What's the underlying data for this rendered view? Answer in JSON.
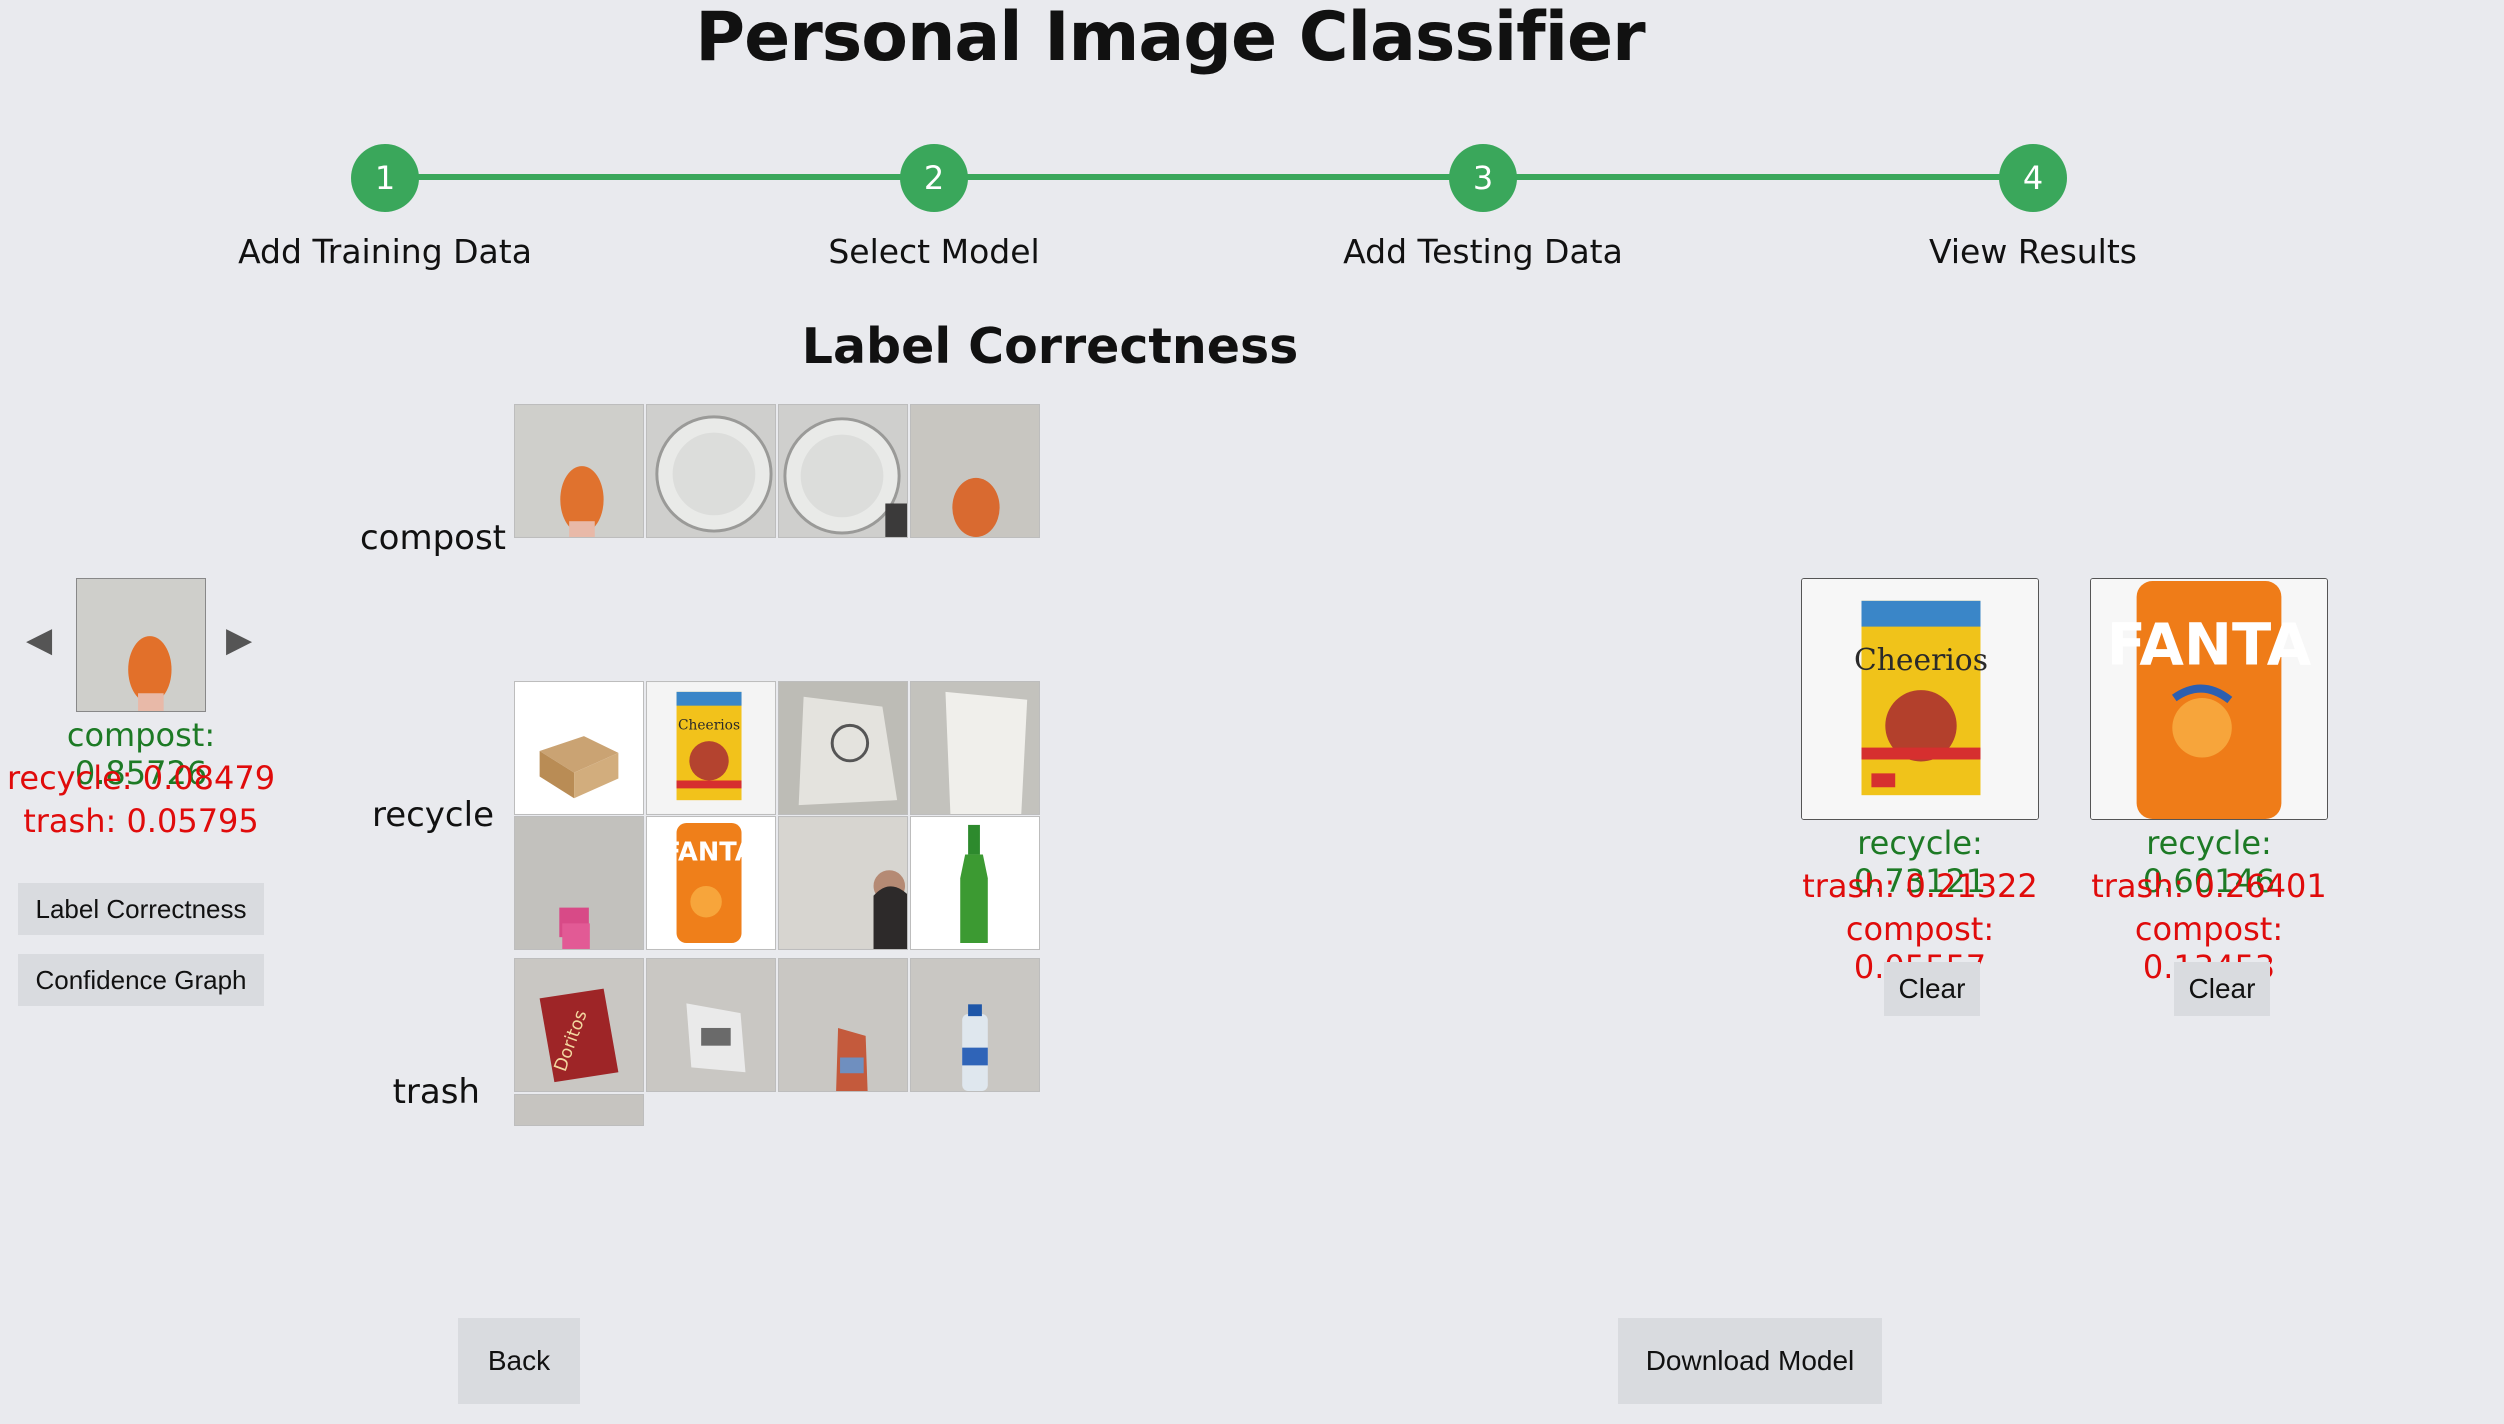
{
  "app": {
    "title": "Personal Image Classifier"
  },
  "steps": [
    {
      "number": "1",
      "label": "Add Training Data"
    },
    {
      "number": "2",
      "label": "Select Model"
    },
    {
      "number": "3",
      "label": "Add Testing Data"
    },
    {
      "number": "4",
      "label": "View Results"
    }
  ],
  "view": {
    "heading": "Label Correctness"
  },
  "labels": {
    "compost": "compost",
    "recycle": "recycle",
    "trash": "trash"
  },
  "selected_image": {
    "scores": [
      {
        "text": "compost: 0.85726",
        "status": "correct"
      },
      {
        "text": "recycle: 0.08479",
        "status": "incorrect"
      },
      {
        "text": "trash: 0.05795",
        "status": "incorrect"
      }
    ],
    "prev_icon": "◀",
    "next_icon": "▶"
  },
  "side_buttons": {
    "label_correctness": "Label Correctness",
    "confidence_graph": "Confidence Graph"
  },
  "results": [
    {
      "image": "cheerios-box",
      "scores": [
        {
          "text": "recycle: 0.73121",
          "status": "correct"
        },
        {
          "text": "trash: 0.21322",
          "status": "incorrect"
        },
        {
          "text": "compost: 0.05557",
          "status": "incorrect"
        }
      ],
      "clear_label": "Clear"
    },
    {
      "image": "fanta-can",
      "scores": [
        {
          "text": "recycle: 0.60146",
          "status": "correct"
        },
        {
          "text": "trash: 0.26401",
          "status": "incorrect"
        },
        {
          "text": "compost: 0.13453",
          "status": "incorrect"
        }
      ],
      "clear_label": "Clear"
    }
  ],
  "footer": {
    "back_label": "Back",
    "download_label": "Download Model"
  },
  "colors": {
    "accent": "#3aa75b",
    "correct": "#1d7a25",
    "incorrect": "#e00b0b"
  }
}
